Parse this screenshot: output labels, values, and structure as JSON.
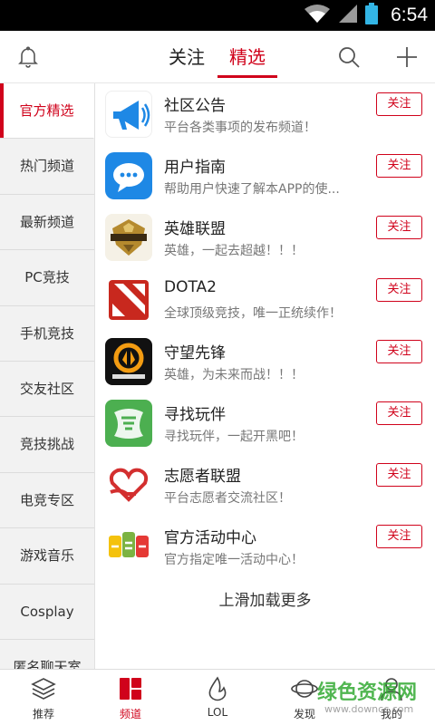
{
  "status": {
    "time": "6:54"
  },
  "header": {
    "tabs": [
      {
        "label": "关注"
      },
      {
        "label": "精选"
      }
    ],
    "active_tab": 1,
    "accent": "#d0021b"
  },
  "sidebar": {
    "items": [
      {
        "label": "官方精选"
      },
      {
        "label": "热门频道"
      },
      {
        "label": "最新频道"
      },
      {
        "label": "PC竞技"
      },
      {
        "label": "手机竞技"
      },
      {
        "label": "交友社区"
      },
      {
        "label": "竞技挑战"
      },
      {
        "label": "电竞专区"
      },
      {
        "label": "游戏音乐"
      },
      {
        "label": "Cosplay"
      },
      {
        "label": "匿名聊天室"
      }
    ],
    "active_index": 0
  },
  "channels": [
    {
      "name": "社区公告",
      "desc": "平台各类事项的发布频道！",
      "follow": "关注",
      "icon": "megaphone-icon"
    },
    {
      "name": "用户指南",
      "desc": "帮助用户快速了解本APP的使...",
      "follow": "关注",
      "icon": "chat-bubble-icon"
    },
    {
      "name": "英雄联盟",
      "desc": "英雄，一起去超越！！！",
      "follow": "关注",
      "icon": "lol-logo-icon"
    },
    {
      "name": "DOTA2",
      "desc": "全球顶级竞技，唯一正统续作！",
      "follow": "关注",
      "icon": "dota2-logo-icon"
    },
    {
      "name": "守望先锋",
      "desc": "英雄，为未来而战！！！",
      "follow": "关注",
      "icon": "overwatch-logo-icon"
    },
    {
      "name": "寻找玩伴",
      "desc": "寻找玩伴，一起开黑吧！",
      "follow": "关注",
      "icon": "find-partner-icon"
    },
    {
      "name": "志愿者联盟",
      "desc": "平台志愿者交流社区！",
      "follow": "关注",
      "icon": "heart-hand-icon"
    },
    {
      "name": "官方活动中心",
      "desc": "官方指定唯一活动中心！",
      "follow": "关注",
      "icon": "event-center-icon"
    }
  ],
  "load_more": "上滑加载更多",
  "bottom_nav": {
    "items": [
      {
        "label": "推荐",
        "icon": "layers-icon"
      },
      {
        "label": "频道",
        "icon": "grid-icon"
      },
      {
        "label": "LOL",
        "icon": "flame-icon"
      },
      {
        "label": "发现",
        "icon": "planet-icon"
      },
      {
        "label": "我的",
        "icon": "person-icon"
      }
    ],
    "active_index": 1
  },
  "watermark": {
    "text": "绿色资源网",
    "url": "www.downcc.com"
  }
}
